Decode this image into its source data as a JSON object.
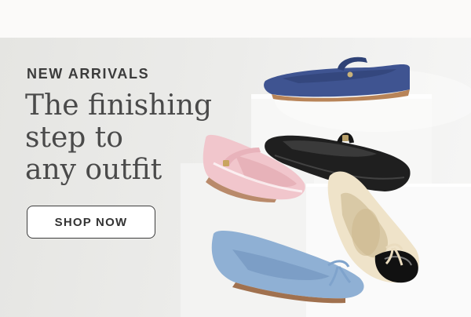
{
  "hero": {
    "eyebrow": "NEW ARRIVALS",
    "headline_lines": [
      "The finishing",
      "step to",
      "any outfit"
    ],
    "cta_label": "SHOP NOW"
  },
  "image": {
    "products": [
      {
        "name": "blue-raffia-mary-jane",
        "color": "#3f5491"
      },
      {
        "name": "pink-patent-mary-jane",
        "color": "#f1c6cc"
      },
      {
        "name": "black-leather-mary-jane",
        "color": "#1f1f1f"
      },
      {
        "name": "cream-cap-toe-ballet-flat",
        "color": "#efe3c9"
      },
      {
        "name": "light-blue-denim-ballet-flat",
        "color": "#8fb0d4"
      }
    ]
  }
}
